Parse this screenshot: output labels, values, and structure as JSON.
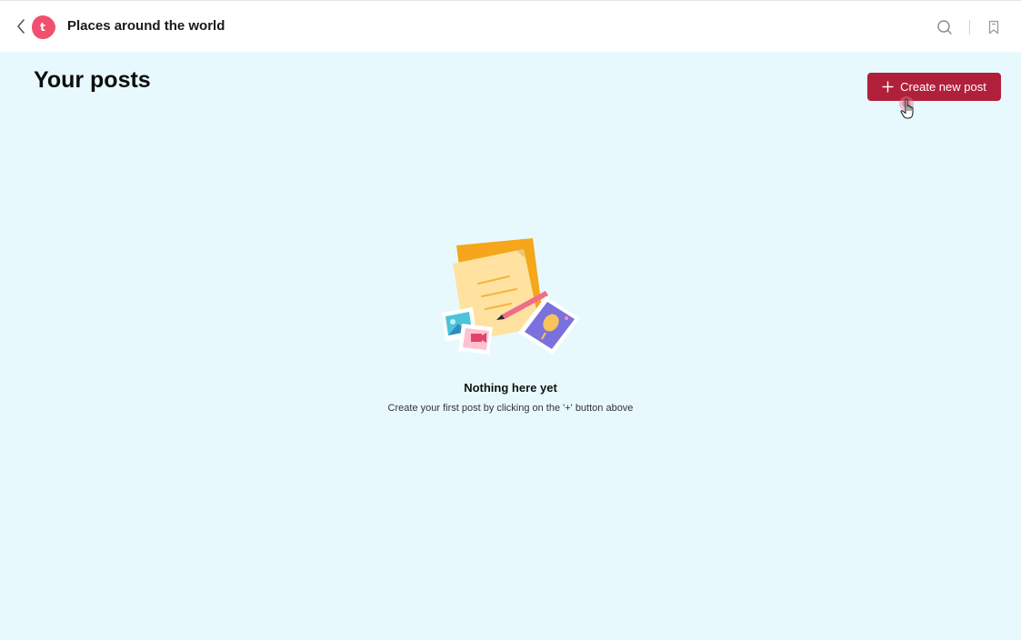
{
  "header": {
    "logo_letter": "t",
    "title": "Places around the world",
    "icons": {
      "back": "chevron-left-icon",
      "search": "search-icon",
      "bookmark": "bookmark-icon"
    }
  },
  "main": {
    "heading": "Your posts",
    "create_button_label": "Create new post",
    "empty_state": {
      "title": "Nothing here yet",
      "subtitle": "Create your first post by clicking on the '+' button above"
    }
  },
  "colors": {
    "brand_red": "#b0203b",
    "logo_red": "#f0506e",
    "page_background": "#e8f9fd"
  }
}
